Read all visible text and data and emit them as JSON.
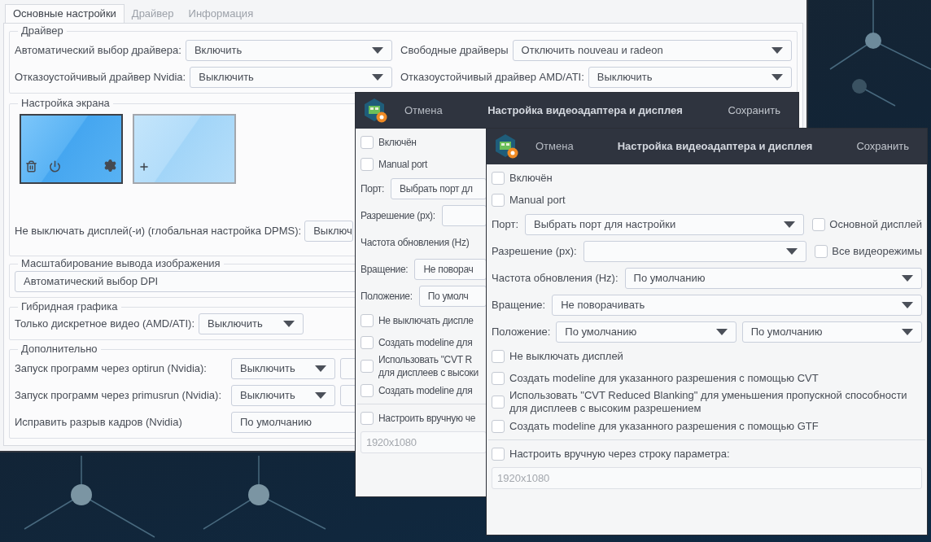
{
  "main_window": {
    "tabs": [
      {
        "label": "Основные настройки",
        "selected": true
      },
      {
        "label": "Драйвер",
        "selected": false
      },
      {
        "label": "Информация",
        "selected": false
      }
    ],
    "driver_group": {
      "title": "Драйвер",
      "fields": [
        {
          "label": "Автоматический выбор драйвера:",
          "value": "Включить"
        },
        {
          "label": "Свободные драйверы",
          "value": "Отключить nouveau и radeon"
        },
        {
          "label": "Отказоустойчивый драйвер Nvidia:",
          "value": "Выключить"
        },
        {
          "label": "Отказоустойчивый драйвер AMD/ATI:",
          "value": "Выключить"
        }
      ]
    },
    "screen_group": {
      "title": "Настройка экрана",
      "displays": [
        {
          "kind": "configured",
          "selected": true
        },
        {
          "kind": "add",
          "selected": false
        }
      ],
      "dpms": {
        "label": "Не выключать дисплей(-и) (глобальная настройка DPMS):",
        "value": "Выключ"
      }
    },
    "scaling_group": {
      "title": "Масштабирование вывода изображения",
      "value": "Автоматический выбор DPI"
    },
    "hybrid_group": {
      "title": "Гибридная графика",
      "label": "Только дискретное видео (AMD/ATI):",
      "value": "Выключить"
    },
    "extra_group": {
      "title": "Дополнительно",
      "rows": [
        {
          "kind": "pair",
          "label": "Запуск программ через optirun (Nvidia):",
          "value": "Выключить"
        },
        {
          "kind": "pair",
          "label": "Запуск программ через primusrun (Nvidia):",
          "value": "Выключить"
        },
        {
          "kind": "single",
          "label": "Исправить разрыв кадров (Nvidia)",
          "value": "По умолчанию"
        }
      ]
    }
  },
  "back_dialog": {
    "cancel": "Отмена",
    "title": "Настройка видеоадаптера и дисплея",
    "save": "Сохранить",
    "rows": [
      {
        "kind": "checkbox",
        "label": "Включён",
        "checked": false
      },
      {
        "kind": "checkbox",
        "label": "Manual port",
        "checked": false
      },
      {
        "kind": "select",
        "label": "Порт:",
        "value": "Выбрать порт дл"
      },
      {
        "kind": "select",
        "label": "Разрешение (px):"
      },
      {
        "kind": "label",
        "label": "Частота обновления (Hz)"
      },
      {
        "kind": "select",
        "label": "Вращение:",
        "value": "Не поворач"
      },
      {
        "kind": "select",
        "label": "Положение:",
        "value": "По умолч"
      },
      {
        "kind": "checkbox",
        "label": "Не выключать диспле",
        "checked": false
      },
      {
        "kind": "checkbox",
        "label": "Создать modeline для",
        "checked": false
      },
      {
        "kind": "checkbox",
        "lines": [
          "Использовать \"CVT R",
          "для дисплеев с высоки"
        ],
        "checked": false
      },
      {
        "kind": "checkbox",
        "label": "Создать modeline для",
        "checked": false
      },
      {
        "kind": "divider"
      },
      {
        "kind": "checkbox",
        "label": "Настроить вручную че",
        "checked": false
      },
      {
        "kind": "input",
        "placeholder": "1920x1080"
      }
    ]
  },
  "front_dialog": {
    "cancel": "Отмена",
    "title": "Настройка видеоадаптера и дисплея",
    "save": "Сохранить",
    "rows": [
      {
        "kind": "checkbox",
        "label": "Включён",
        "checked": false
      },
      {
        "kind": "checkbox",
        "label": "Manual port",
        "checked": false
      },
      {
        "kind": "select",
        "label": "Порт:",
        "value": "Выбрать порт для настройки",
        "side": {
          "label": "Основной дисплей",
          "checked": false
        }
      },
      {
        "kind": "select",
        "label": "Разрешение (px):",
        "side": {
          "label": "Все видеорежимы",
          "checked": false
        }
      },
      {
        "kind": "select",
        "label": "Частота обновления (Hz):",
        "value": "По умолчанию"
      },
      {
        "kind": "select",
        "label": "Вращение:",
        "value": "Не поворачивать"
      },
      {
        "kind": "pair",
        "label": "Положение:",
        "values": [
          "По умолчанию",
          "По умолчанию"
        ]
      },
      {
        "kind": "checkbox",
        "label": "Не выключать дисплей",
        "checked": false
      },
      {
        "kind": "checkbox",
        "label": "Создать modeline для указанного разрешения с помощью CVT",
        "checked": false
      },
      {
        "kind": "checkbox",
        "label": "Использовать \"CVT Reduced Blanking\" для уменьшения пропускной способности для дисплеев с высоким разрешением",
        "checked": false
      },
      {
        "kind": "checkbox",
        "label": "Создать modeline для указанного разрешения с помощью GTF",
        "checked": false
      },
      {
        "kind": "divider"
      },
      {
        "kind": "checkbox",
        "label": "Настроить вручную через строку параметра:",
        "checked": false
      },
      {
        "kind": "input",
        "placeholder": "1920x1080"
      }
    ]
  }
}
